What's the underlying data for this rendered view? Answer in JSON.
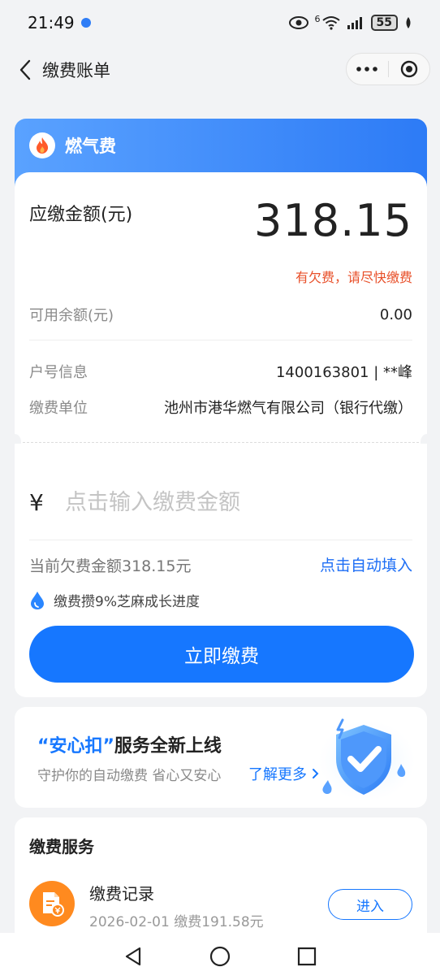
{
  "status_bar": {
    "time": "21:49",
    "network": "6",
    "battery": "55"
  },
  "nav": {
    "title": "缴费账单"
  },
  "bill": {
    "category": "燃气费",
    "due_label": "应缴金额(元)",
    "due_amount": "318.15",
    "warning": "有欠费，请尽快缴费",
    "balance_label": "可用余额(元)",
    "balance_value": "0.00",
    "account_label": "户号信息",
    "account_value": "1400163801 | **峰",
    "unit_label": "缴费单位",
    "unit_value": "池州市港华燃气有限公司（银行代缴）"
  },
  "payment": {
    "currency_symbol": "¥",
    "input_placeholder": "点击输入缴费金额",
    "owe_text": "当前欠费金额318.15元",
    "autofill_link": "点击自动填入",
    "growth_text": "缴费攒9%芝麻成长进度",
    "pay_button": "立即缴费"
  },
  "promo": {
    "title_highlight": "“安心扣”",
    "title_rest": "服务全新上线",
    "subtitle": "守护你的自动缴费 省心又安心",
    "link": "了解更多"
  },
  "services": {
    "title": "缴费服务",
    "record_title": "缴费记录",
    "record_sub": "2026-02-01 缴费191.58元",
    "enter_button": "进入"
  },
  "colors": {
    "accent": "#1677ff",
    "warning": "#e8502a",
    "record_icon": "#ff8a1f"
  }
}
